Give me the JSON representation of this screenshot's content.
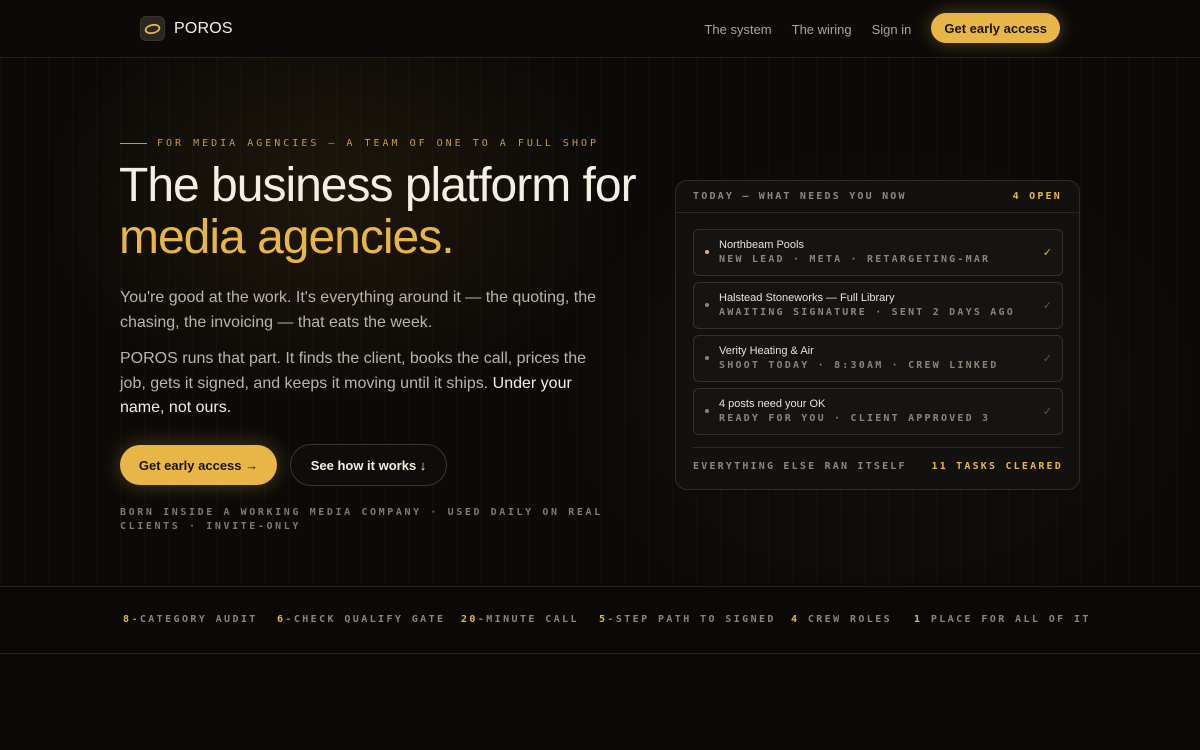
{
  "brand": {
    "name": "POROS"
  },
  "nav": {
    "links": [
      "The system",
      "The wiring",
      "Sign in"
    ],
    "cta": "Get early access"
  },
  "hero": {
    "eyebrow": "FOR MEDIA AGENCIES — A TEAM OF ONE TO A FULL SHOP",
    "title_line1": "The business platform for",
    "title_line2": "media agencies.",
    "para1": "You're good at the work. It's everything around it — the quoting, the chasing, the invoicing — that eats the week.",
    "para2": "POROS runs that part. It finds the client, books the call, prices the job, gets it signed, and keeps it moving until it ships. ",
    "para2_strong": "Under your name, not ours.",
    "primary_cta": "Get early access →",
    "secondary_cta": "See how it works ↓",
    "fineprint": "BORN INSIDE A WORKING MEDIA COMPANY · USED DAILY ON REAL CLIENTS · INVITE-ONLY"
  },
  "card": {
    "header_title": "TODAY — WHAT NEEDS YOU NOW",
    "header_count": "4 OPEN",
    "tasks": [
      {
        "name": "Northbeam Pools",
        "meta": "NEW LEAD · META · RETARGETING-MAR",
        "active": true
      },
      {
        "name": "Halstead Stoneworks — Full Library",
        "meta": "AWAITING SIGNATURE · SENT 2 DAYS AGO",
        "active": false
      },
      {
        "name": "Verity Heating & Air",
        "meta": "SHOOT TODAY · 8:30AM · CREW LINKED",
        "active": false
      },
      {
        "name": "4 posts need your OK",
        "meta": "READY FOR YOU · CLIENT APPROVED 3",
        "active": false
      }
    ],
    "footer_text": "EVERYTHING ELSE RAN ITSELF",
    "footer_count": "11 TASKS CLEARED"
  },
  "stats": [
    {
      "num": "8",
      "label": "-CATEGORY AUDIT"
    },
    {
      "num": "6",
      "label": "-CHECK QUALIFY GATE"
    },
    {
      "num": "20",
      "label": "-MINUTE CALL"
    },
    {
      "num": "5",
      "label": "-STEP PATH TO SIGNED"
    },
    {
      "num": "4",
      "label": " CREW ROLES"
    },
    {
      "num": "1",
      "label": " PLACE FOR ALL OF IT"
    }
  ],
  "colors": {
    "accent": "#e8b547",
    "background": "#0b0a08",
    "card": "#121110"
  }
}
